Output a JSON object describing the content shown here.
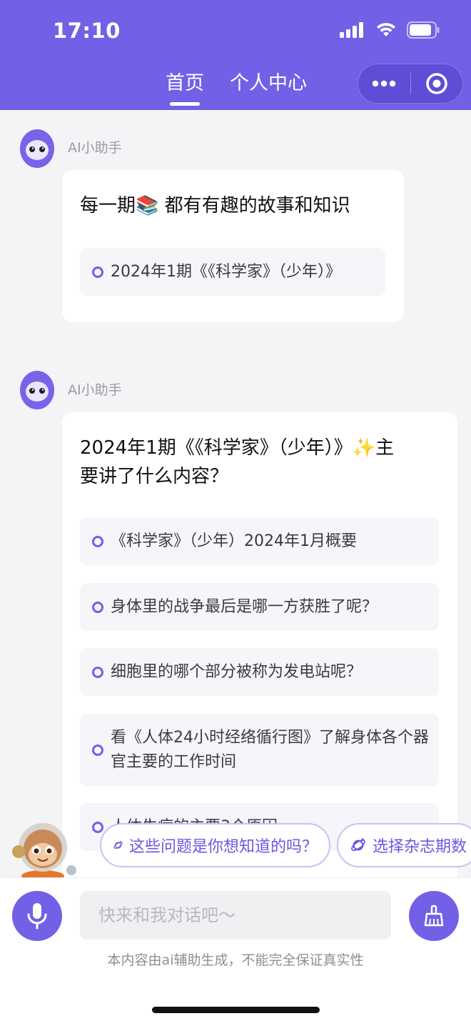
{
  "status_bar": {
    "time": "17:10"
  },
  "nav": {
    "tabs": [
      {
        "label": "首页",
        "active": true
      },
      {
        "label": "个人中心",
        "active": false
      }
    ]
  },
  "messages": [
    {
      "sender": "AI小助手",
      "title": "每一期📚 都有有趣的故事和知识",
      "options": [
        "2024年1期《《科学家》（少年）》"
      ]
    },
    {
      "sender": "AI小助手",
      "title_line1": "2024年1期《《科学家》（少年）》✨主",
      "title_line2": "要讲了什么内容？",
      "options": [
        "《科学家》（少年）2024年1月概要",
        "身体里的战争最后是哪一方获胜了呢？",
        "细胞里的哪个部分被称为发电站呢？",
        "看《人体24小时经络循行图》了解身体各个器官主要的工作时间",
        "人体生病的主要3个原因"
      ]
    }
  ],
  "chips": [
    {
      "label": "这些问题是你想知道的吗？",
      "icon": "planet-icon"
    },
    {
      "label": "选择杂志期数",
      "icon": "planet-icon"
    }
  ],
  "input": {
    "placeholder": "快来和我对话吧～",
    "value": ""
  },
  "disclaimer": "本内容由ai辅助生成，不能完全保证真实性",
  "colors": {
    "brand": "#7260e6",
    "background": "#f4f4f6",
    "option_bg": "#f5f5fa"
  }
}
